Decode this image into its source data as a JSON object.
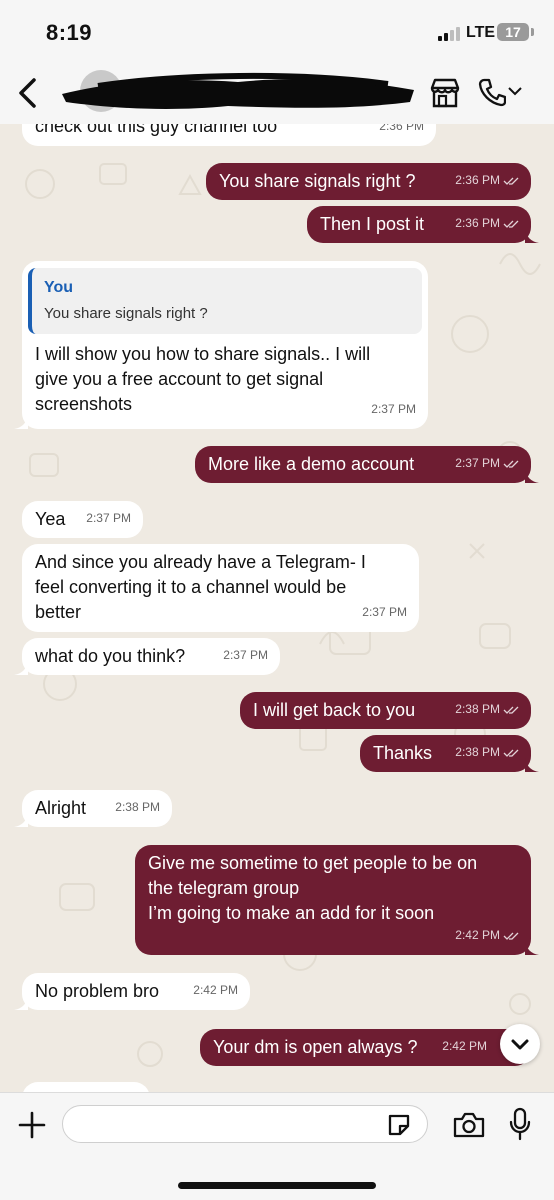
{
  "status_bar": {
    "time": "8:19",
    "network": "LTE",
    "battery": "17"
  },
  "header": {
    "contact_name": "",
    "icons": [
      "back-icon",
      "store-icon",
      "call-icon",
      "chevron-down-icon"
    ]
  },
  "messages": [
    {
      "dir": "in",
      "text": "check out this guy channel too",
      "time": "2:36 PM"
    },
    {
      "dir": "out",
      "text": "You share signals right ?",
      "time": "2:36 PM"
    },
    {
      "dir": "out",
      "text": "Then I post it",
      "time": "2:36 PM"
    },
    {
      "dir": "in",
      "quote_name": "You",
      "quote_text": "You share signals right ?",
      "text": "I will show you how to share signals.. I will\ngive you a free account to get signal\nscreenshots",
      "time": "2:37 PM"
    },
    {
      "dir": "out",
      "text": "More like a demo account",
      "time": "2:37 PM"
    },
    {
      "dir": "in",
      "text": "Yea",
      "time": "2:37 PM"
    },
    {
      "dir": "in",
      "text": "And since you already have a Telegram- I\nfeel converting it to a channel would be\nbetter",
      "time": "2:37 PM"
    },
    {
      "dir": "in",
      "text": "what do you think?",
      "time": "2:37 PM"
    },
    {
      "dir": "out",
      "text": "I will get back to you",
      "time": "2:38 PM"
    },
    {
      "dir": "out",
      "text": "Thanks",
      "time": "2:38 PM"
    },
    {
      "dir": "in",
      "text": "Alright",
      "time": "2:38 PM"
    },
    {
      "dir": "out",
      "text": "Give me sometime to get people to be on\nthe telegram group\nI’m going to make an add for it soon",
      "time": "2:42 PM"
    },
    {
      "dir": "in",
      "text": "No problem bro",
      "time": "2:42 PM"
    },
    {
      "dir": "out",
      "text": "Your dm is open always ?",
      "time": "2:42 PM"
    }
  ],
  "input": {
    "value": "",
    "placeholder": ""
  },
  "colors": {
    "outgoing_bubble": "#6e1d32",
    "incoming_bubble": "#ffffff",
    "chat_background": "#efeae2",
    "quote_accent": "#1a5fb4"
  }
}
